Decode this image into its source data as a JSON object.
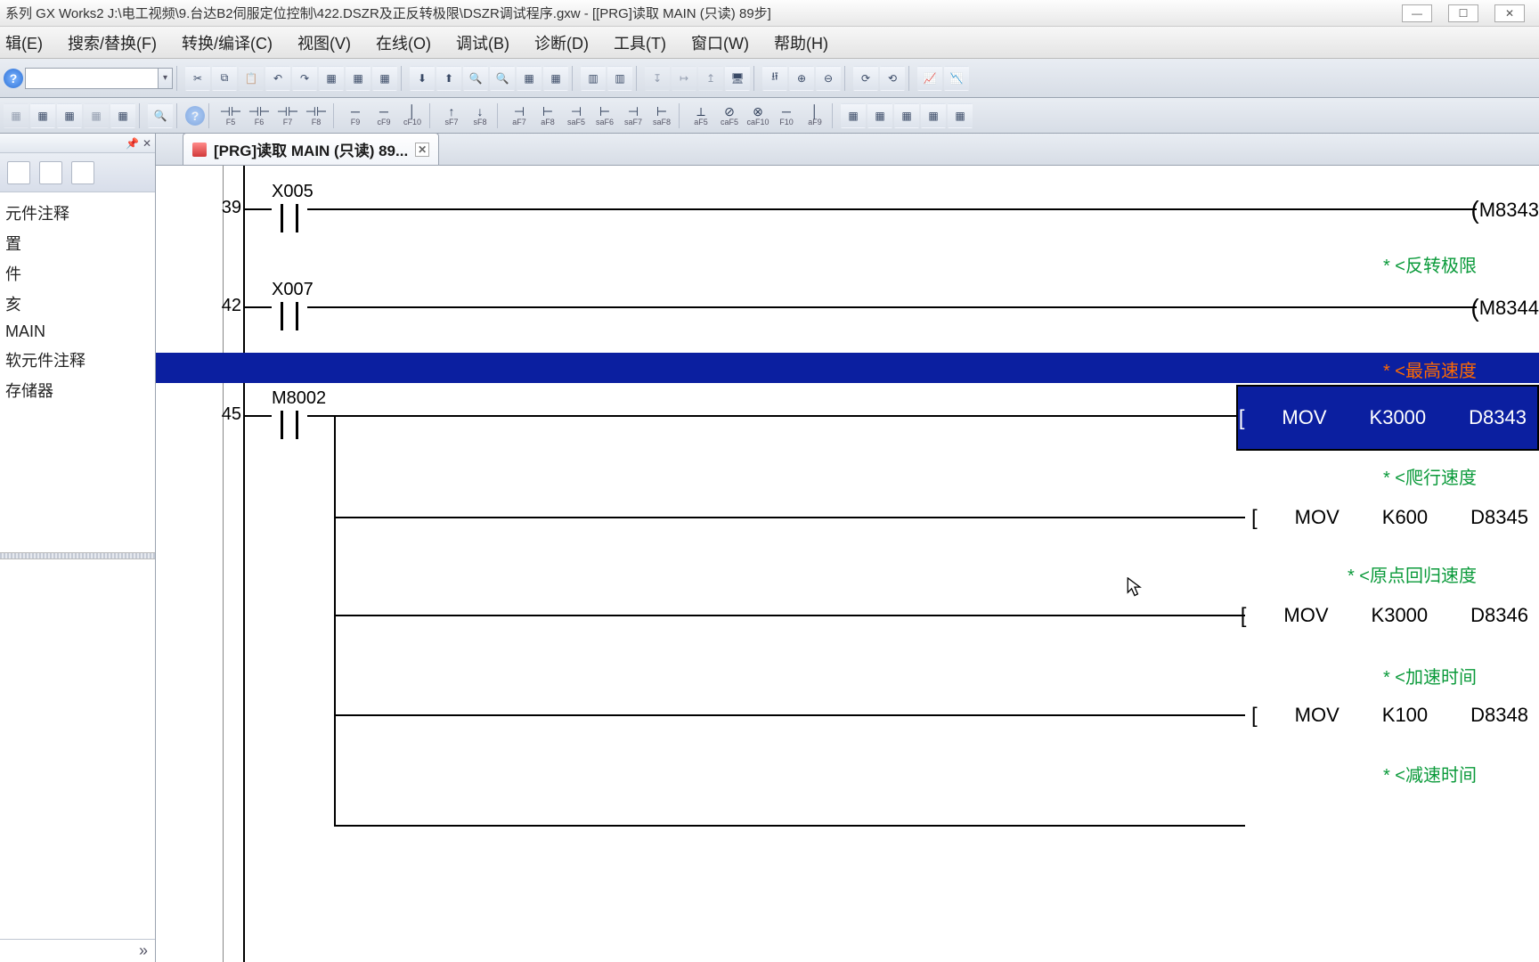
{
  "title": "系列 GX Works2 J:\\电工视频\\9.台达B2伺服定位控制\\422.DSZR及正反转极限\\DSZR调试程序.gxw - [[PRG]读取 MAIN (只读) 89步]",
  "menu": {
    "edit": "辑(E)",
    "search": "搜索/替换(F)",
    "convert": "转换/编译(C)",
    "view": "视图(V)",
    "online": "在线(O)",
    "debug": "调试(B)",
    "diagnose": "诊断(D)",
    "tools": "工具(T)",
    "window": "窗口(W)",
    "help": "帮助(H)"
  },
  "tab": {
    "label": "[PRG]读取 MAIN (只读) 89..."
  },
  "tree": {
    "n0": "元件注释",
    "n1": "置",
    "n2": "件",
    "n3": "亥",
    "n4": "MAIN",
    "n5": "软元件注释",
    "n6": "存储器"
  },
  "ladder": {
    "rungs": [
      {
        "step": "39",
        "contact": "X005",
        "coil": "M8343",
        "comment": "* <反转极限"
      },
      {
        "step": "42",
        "contact": "X007",
        "coil": "M8344",
        "comment": ""
      },
      {
        "step": "45",
        "contact": "M8002",
        "comment_top": "* <最高速度",
        "instr1": {
          "op": "MOV",
          "src": "K3000",
          "dst": "D8343"
        },
        "comment2": "* <爬行速度",
        "instr2": {
          "op": "MOV",
          "src": "K600",
          "dst": "D8345"
        },
        "comment3": "* <原点回归速度",
        "instr3": {
          "op": "MOV",
          "src": "K3000",
          "dst": "D8346"
        },
        "comment4": "* <加速时间",
        "instr4": {
          "op": "MOV",
          "src": "K100",
          "dst": "D8348"
        },
        "comment5": "* <减速时间"
      }
    ]
  },
  "fkeys": [
    "F5",
    "F6",
    "F7",
    "F8",
    "F9",
    "cF9",
    "cF10",
    "sF7",
    "sF8",
    "aF7",
    "aF8",
    "saF5",
    "saF6",
    "saF7",
    "saF8",
    "aF5",
    "caF5",
    "caF10",
    "F10",
    "aF9"
  ]
}
